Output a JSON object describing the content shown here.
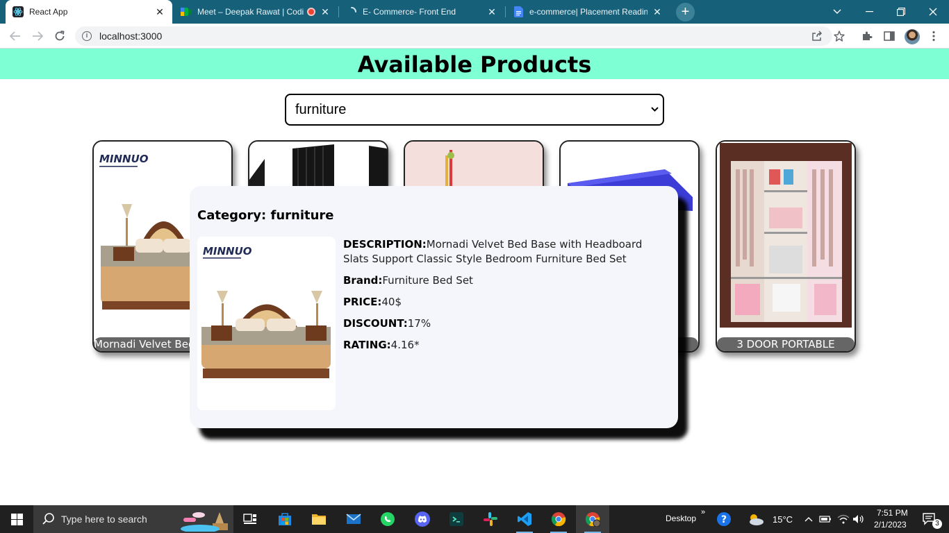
{
  "browser": {
    "tabs": [
      {
        "title": "React App",
        "active": true
      },
      {
        "title": "Meet – Deepak Rawat | Codi",
        "active": false
      },
      {
        "title": "E- Commerce- Front End",
        "active": false
      },
      {
        "title": "e-commerce| Placement Readine",
        "active": false
      }
    ],
    "new_tab": "+",
    "url": "localhost:3000"
  },
  "page": {
    "title": "Available Products",
    "category_select": {
      "value": "furniture"
    },
    "cards": [
      {
        "caption": "Mornadi Velvet Bed Base with Headboard Slats"
      },
      {
        "caption": ""
      },
      {
        "caption": ""
      },
      {
        "caption": ""
      },
      {
        "caption": "3 DOOR PORTABLE"
      }
    ],
    "modal": {
      "category_label": "Category: furniture",
      "description_label": "DESCRIPTION:",
      "description": "Mornadi Velvet Bed Base with Headboard Slats Support Classic Style Bedroom Furniture Bed Set",
      "brand_label": "Brand:",
      "brand": "Furniture Bed Set",
      "price_label": "PRICE:",
      "price": "40$",
      "discount_label": "DISCOUNT:",
      "discount": "17%",
      "rating_label": "RATING:",
      "rating": "4.16*",
      "logo_text": "MINNUO"
    }
  },
  "taskbar": {
    "search_placeholder": "Type here to search",
    "desktop_label": "Desktop",
    "chevron": "»",
    "weather": "15°C",
    "time": "7:51 PM",
    "date": "2/1/2023",
    "notification_count": "3"
  },
  "colors": {
    "header_bg": "#7fffd4",
    "tabstrip_bg": "#16607a",
    "modal_bg": "#f5f6fb"
  }
}
